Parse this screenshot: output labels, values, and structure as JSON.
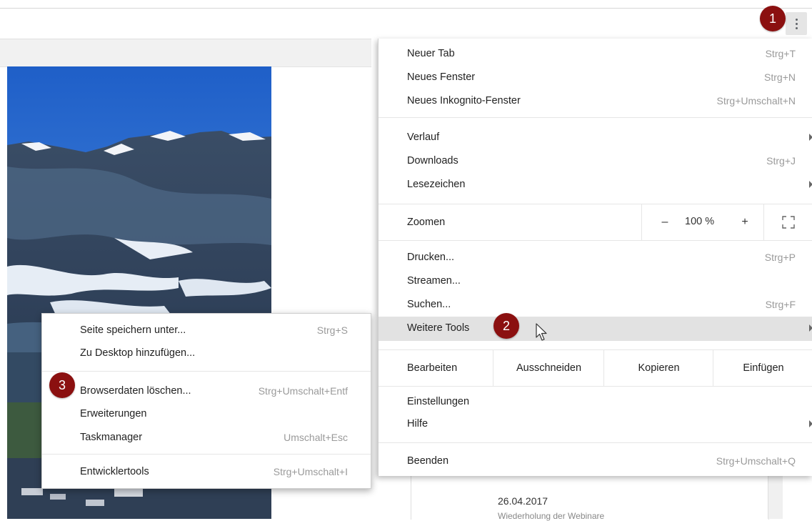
{
  "menu": {
    "items_top": [
      {
        "label": "Neuer Tab",
        "shortcut": "Strg+T"
      },
      {
        "label": "Neues Fenster",
        "shortcut": "Strg+N"
      },
      {
        "label": "Neues Inkognito-Fenster",
        "shortcut": "Strg+Umschalt+N"
      }
    ],
    "items_history": [
      {
        "label": "Verlauf",
        "shortcut": ""
      },
      {
        "label": "Downloads",
        "shortcut": "Strg+J"
      },
      {
        "label": "Lesezeichen",
        "shortcut": ""
      }
    ],
    "zoom": {
      "label": "Zoomen",
      "minus": "–",
      "value": "100 %",
      "plus": "+"
    },
    "items_tools": [
      {
        "label": "Drucken...",
        "shortcut": "Strg+P"
      },
      {
        "label": "Streamen...",
        "shortcut": ""
      },
      {
        "label": "Suchen...",
        "shortcut": "Strg+F"
      },
      {
        "label": "Weitere Tools",
        "shortcut": ""
      }
    ],
    "edit": {
      "label": "Bearbeiten",
      "cut": "Ausschneiden",
      "copy": "Kopieren",
      "paste": "Einfügen"
    },
    "items_settings": [
      {
        "label": "Einstellungen",
        "shortcut": ""
      },
      {
        "label": "Hilfe",
        "shortcut": ""
      }
    ],
    "quit": {
      "label": "Beenden",
      "shortcut": "Strg+Umschalt+Q"
    }
  },
  "submenu": {
    "items": [
      {
        "label": "Seite speichern unter...",
        "shortcut": "Strg+S"
      },
      {
        "label": "Zu Desktop hinzufügen...",
        "shortcut": ""
      },
      {
        "label": "Browserdaten löschen...",
        "shortcut": "Strg+Umschalt+Entf"
      },
      {
        "label": "Erweiterungen",
        "shortcut": ""
      },
      {
        "label": "Taskmanager",
        "shortcut": "Umschalt+Esc"
      },
      {
        "label": "Entwicklertools",
        "shortcut": "Strg+Umschalt+I"
      }
    ]
  },
  "badges": {
    "one": "1",
    "two": "2",
    "three": "3"
  },
  "page": {
    "date": "26.04.2017",
    "subtitle": "Wiederholung der Webinare"
  },
  "colors": {
    "badge": "#8b1010",
    "highlight": "#e2e2e2",
    "shortcut": "#9a9a9a"
  },
  "icons": {
    "menu": "kebab-menu-icon",
    "fullscreen": "fullscreen-icon",
    "submenu": "submenu-arrow-icon",
    "cursor": "mouse-cursor-icon"
  }
}
